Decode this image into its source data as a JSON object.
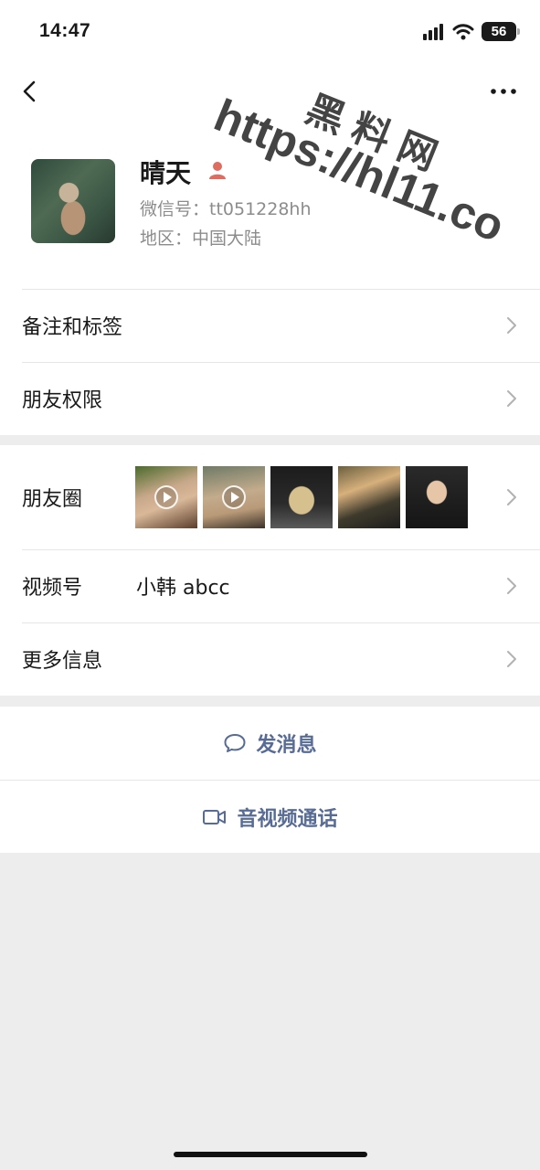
{
  "status_bar": {
    "time": "14:47",
    "battery": "56"
  },
  "profile": {
    "name": "晴天",
    "wechat_id": "微信号：tt051228hh",
    "region": "地区：中国大陆"
  },
  "menu1": [
    {
      "label": "备注和标签"
    },
    {
      "label": "朋友权限"
    }
  ],
  "moments": {
    "label": "朋友圈"
  },
  "channels": {
    "label": "视频号",
    "value": "小韩 abcc"
  },
  "more_info": {
    "label": "更多信息"
  },
  "actions": {
    "message": "发消息",
    "call": "音视频通话"
  },
  "watermark": {
    "brand": "黑料网",
    "url": "https://hl11.co"
  },
  "colors": {
    "link": "#576b95",
    "background": "#ededed",
    "accent_icon": "#e06b5f"
  }
}
